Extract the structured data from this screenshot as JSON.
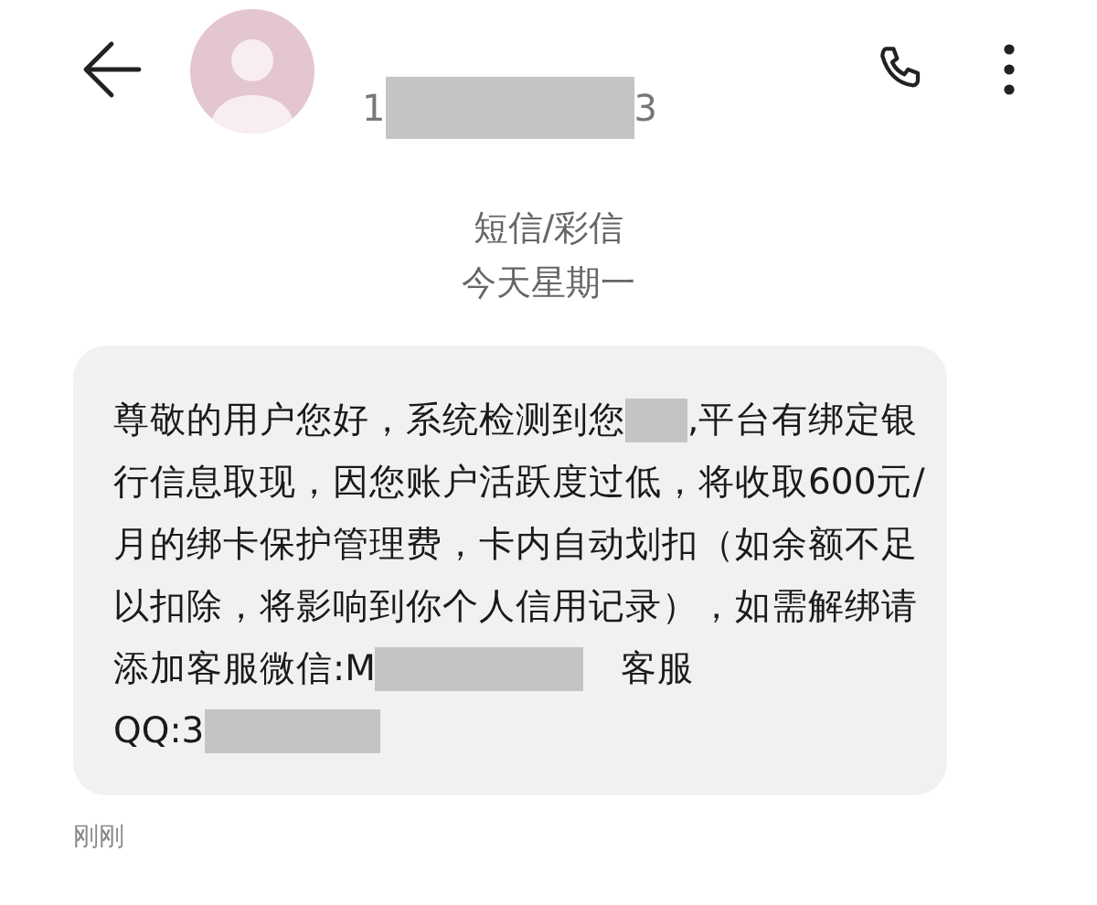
{
  "contact": {
    "number": [
      {
        "kind": "text",
        "text": "1"
      },
      {
        "kind": "redaction-long"
      },
      {
        "kind": "text",
        "text": "3"
      }
    ]
  },
  "thread_info": {
    "channel": "短信/彩信",
    "date": "今天星期一"
  },
  "message": {
    "lines": [
      [
        {
          "kind": "text",
          "text": "尊敬的用户您好，系统检测到您"
        },
        {
          "kind": "redaction-short"
        },
        {
          "kind": "text",
          "text": ",平台有绑定银"
        }
      ],
      [
        {
          "kind": "text",
          "text": "行信息取现，因您账户活跃度过低，将收取600元/"
        }
      ],
      [
        {
          "kind": "text",
          "text": "月的绑卡保护管理费，卡内自动划扣（如余额不足"
        }
      ],
      [
        {
          "kind": "text",
          "text": "以扣除，将影响到你个人信用记录），如需解绑请"
        }
      ],
      [
        {
          "kind": "text",
          "text": "添加客服微信:M"
        },
        {
          "kind": "redaction-long"
        },
        {
          "kind": "text",
          "text": "客服"
        }
      ],
      [
        {
          "kind": "text",
          "text": "QQ:3"
        },
        {
          "kind": "redaction-medium"
        }
      ]
    ],
    "time": "刚刚"
  }
}
